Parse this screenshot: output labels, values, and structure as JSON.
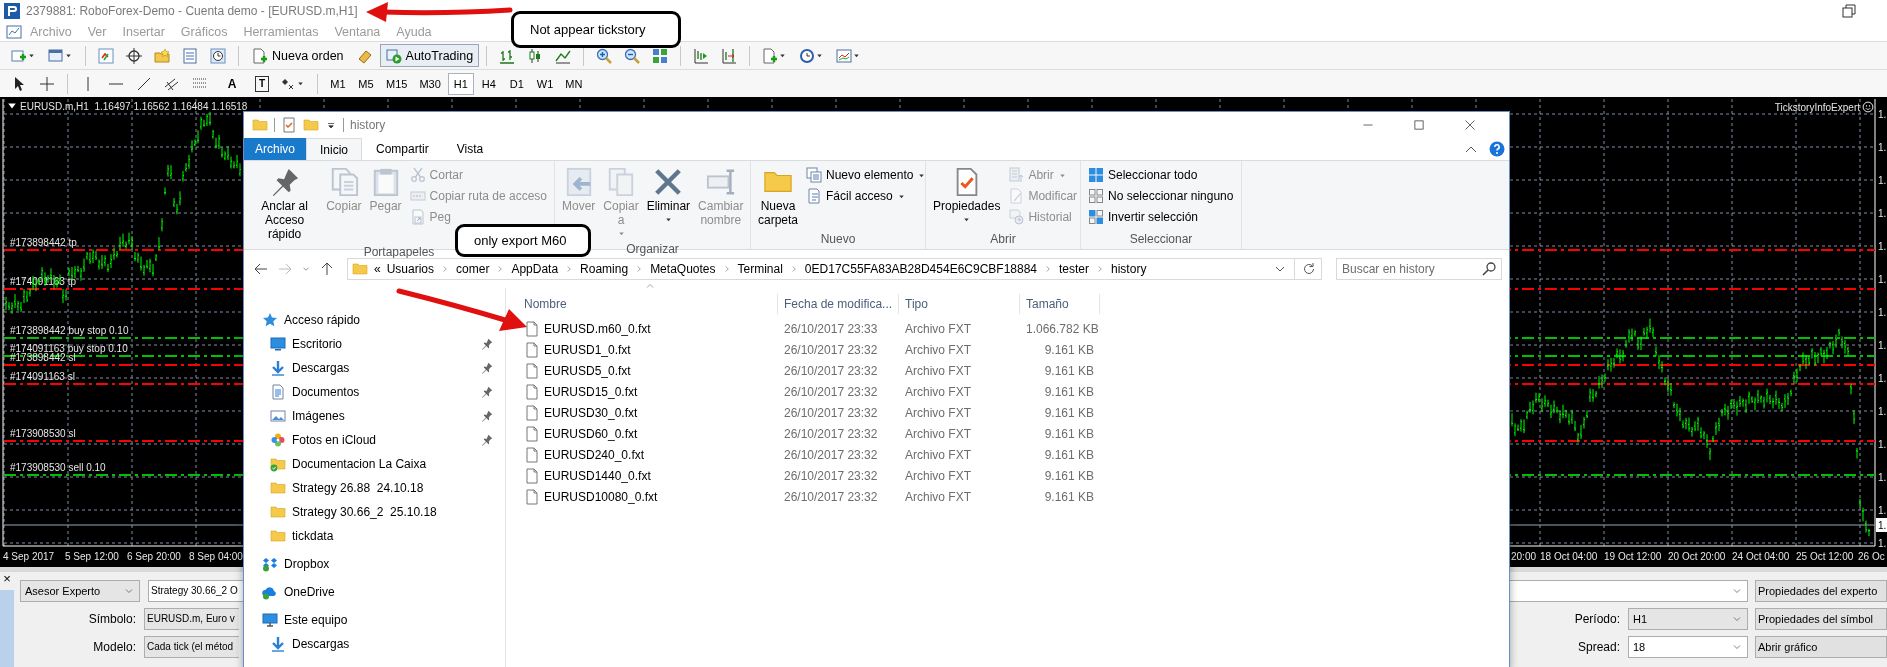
{
  "mt4": {
    "title": "2379881: RoboForex-Demo - Cuenta demo - [EURUSD.m,H1]",
    "menu": [
      "Archivo",
      "Ver",
      "Insertar",
      "Gráficos",
      "Herramientas",
      "Ventana",
      "Ayuda"
    ],
    "toolbar_buttons": [
      {
        "label": "Nueva orden",
        "pressed": false
      },
      {
        "label": "AutoTrading",
        "pressed": true
      }
    ],
    "tool_glyphs": [
      "A",
      "T"
    ],
    "timeframes": [
      {
        "label": "M1",
        "selected": false
      },
      {
        "label": "M5",
        "selected": false
      },
      {
        "label": "M15",
        "selected": false
      },
      {
        "label": "M30",
        "selected": false
      },
      {
        "label": "H1",
        "selected": true
      },
      {
        "label": "H4",
        "selected": false
      },
      {
        "label": "D1",
        "selected": false
      },
      {
        "label": "W1",
        "selected": false
      },
      {
        "label": "MN",
        "selected": false
      }
    ]
  },
  "chart": {
    "header": "EURUSD.m,H1  1.16497 1.16562 1.16484 1.16518",
    "expert": "TickstoryInfoExpert",
    "order_lines": [
      {
        "label": "#173898442 tp",
        "color": "#ff0000"
      },
      {
        "label": "#174091163 tp",
        "color": "#ff0000"
      },
      {
        "label": "#173898442 buy stop 0.10",
        "color": "#00c000"
      },
      {
        "label": "#174091163 buy stop 0.10",
        "color": "#00c000"
      },
      {
        "label": "#173898442 sl",
        "color": "#ff0000"
      },
      {
        "label": "#174091163 sl",
        "color": "#ff0000"
      },
      {
        "label": "#173908530 sl",
        "color": "#ff0000"
      },
      {
        "label": "#173908530 sell 0.10",
        "color": "#00c000"
      }
    ],
    "dates_left": [
      "4 Sep 2017",
      "5 Sep 12:00",
      "6 Sep 20:00",
      "8 Sep 04:00"
    ],
    "dates_right": [
      "20:00",
      "18 Oct 04:00",
      "19 Oct 12:00",
      "20 Oct 20:00",
      "24 Oct 04:00",
      "25 Oct 12:00",
      "26 Oc"
    ],
    "price_labels": [
      "1.",
      "1.",
      "1.",
      "1.",
      "1.",
      "1.",
      "1.",
      "1.",
      "1.",
      "1.",
      "1.",
      "1.",
      "1.",
      "1."
    ],
    "current_price": "1."
  },
  "tester": {
    "close": "×",
    "mode": "Asesor Experto",
    "expert": "Strategy 30.66_2 O",
    "fields": [
      {
        "label": "Símbolo:",
        "value": "EURUSD.m, Euro v"
      },
      {
        "label": "Modelo:",
        "value": "Cada tick (el métod"
      }
    ],
    "right_fields": [
      {
        "label": "Período:",
        "value": "H1"
      },
      {
        "label": "Spread:",
        "value": "18"
      }
    ],
    "buttons": [
      "Propiedades del experto",
      "Propiedades del símbol",
      "Abrir gráfico"
    ]
  },
  "explorer": {
    "title": "history",
    "tabs": [
      {
        "label": "Archivo",
        "kind": "file",
        "selected": false
      },
      {
        "label": "Inicio",
        "kind": "tab",
        "selected": true
      },
      {
        "label": "Compartir",
        "kind": "tab",
        "selected": false
      },
      {
        "label": "Vista",
        "kind": "tab",
        "selected": false
      }
    ],
    "ribbon": [
      {
        "label": "Portapapeles",
        "items": [
          {
            "label": "Anclar al\nAcceso rápido",
            "kind": "large",
            "disabled": false,
            "dropdown": false
          },
          {
            "label": "Copiar",
            "kind": "large",
            "disabled": true,
            "dropdown": false
          },
          {
            "label": "Pegar",
            "kind": "large",
            "disabled": true,
            "dropdown": false
          },
          {
            "label": "Cortar",
            "kind": "small",
            "disabled": true,
            "dropdown": false
          },
          {
            "label": "Copiar ruta de acceso",
            "kind": "small",
            "disabled": true,
            "dropdown": false
          },
          {
            "label": "Peg",
            "kind": "small",
            "disabled": true,
            "dropdown": false
          }
        ]
      },
      {
        "label": "Organizar",
        "items": [
          {
            "label": "Mover",
            "kind": "large",
            "disabled": true,
            "dropdown": false
          },
          {
            "label": "Copiar\na",
            "kind": "large",
            "disabled": true,
            "dropdown": true
          },
          {
            "label": "Eliminar",
            "kind": "large",
            "disabled": false,
            "dropdown": true
          },
          {
            "label": "Cambiar\nnombre",
            "kind": "large",
            "disabled": true,
            "dropdown": false
          }
        ]
      },
      {
        "label": "Nuevo",
        "items": [
          {
            "label": "Nueva\ncarpeta",
            "kind": "large",
            "disabled": false,
            "dropdown": false
          },
          {
            "label": "Nuevo elemento",
            "kind": "small",
            "disabled": false,
            "dropdown": true
          },
          {
            "label": "Fácil acceso",
            "kind": "small",
            "disabled": false,
            "dropdown": true
          }
        ]
      },
      {
        "label": "Abrir",
        "items": [
          {
            "label": "Propiedades",
            "kind": "large",
            "disabled": false,
            "dropdown": true
          },
          {
            "label": "Abrir",
            "kind": "small",
            "disabled": true,
            "dropdown": true
          },
          {
            "label": "Modificar",
            "kind": "small",
            "disabled": true,
            "dropdown": false
          },
          {
            "label": "Historial",
            "kind": "small",
            "disabled": true,
            "dropdown": false
          }
        ]
      },
      {
        "label": "Seleccionar",
        "items": [
          {
            "label": "Seleccionar todo",
            "kind": "small",
            "disabled": false,
            "dropdown": false
          },
          {
            "label": "No seleccionar ninguno",
            "kind": "small",
            "disabled": false,
            "dropdown": false
          },
          {
            "label": "Invertir selección",
            "kind": "small",
            "disabled": false,
            "dropdown": false
          }
        ]
      }
    ],
    "path_prefix": "«",
    "path": [
      "Usuarios",
      "comer",
      "AppData",
      "Roaming",
      "MetaQuotes",
      "Terminal",
      "0ED17C55FA83AB28D454E6C9CBF18884",
      "tester",
      "history"
    ],
    "search": {
      "placeholder": "Buscar en history"
    },
    "nav": [
      {
        "label": "Acceso rápido",
        "children": [
          {
            "label": "Escritorio",
            "pinned": true
          },
          {
            "label": "Descargas",
            "pinned": true
          },
          {
            "label": "Documentos",
            "pinned": true
          },
          {
            "label": "Imágenes",
            "pinned": true
          },
          {
            "label": "Fotos en iCloud",
            "pinned": true
          },
          {
            "label": "Documentacion La Caixa",
            "pinned": false
          },
          {
            "label": "Strategy 26.88  24.10.18",
            "pinned": false
          },
          {
            "label": "Strategy 30.66_2  25.10.18",
            "pinned": false
          },
          {
            "label": "tickdata",
            "pinned": false
          }
        ]
      },
      {
        "label": "Dropbox"
      },
      {
        "label": "OneDrive"
      },
      {
        "label": "Este equipo",
        "children": [
          {
            "label": "Descargas",
            "pinned": false
          }
        ]
      }
    ],
    "columns": [
      "Nombre",
      "Fecha de modifica...",
      "Tipo",
      "Tamaño"
    ],
    "files": [
      {
        "name": "EURUSD.m60_0.fxt",
        "date": "26/10/2017 23:33",
        "type": "Archivo FXT",
        "size": "1.066.782 KB"
      },
      {
        "name": "EURUSD1_0.fxt",
        "date": "26/10/2017 23:32",
        "type": "Archivo FXT",
        "size": "9.161 KB"
      },
      {
        "name": "EURUSD5_0.fxt",
        "date": "26/10/2017 23:32",
        "type": "Archivo FXT",
        "size": "9.161 KB"
      },
      {
        "name": "EURUSD15_0.fxt",
        "date": "26/10/2017 23:32",
        "type": "Archivo FXT",
        "size": "9.161 KB"
      },
      {
        "name": "EURUSD30_0.fxt",
        "date": "26/10/2017 23:32",
        "type": "Archivo FXT",
        "size": "9.161 KB"
      },
      {
        "name": "EURUSD60_0.fxt",
        "date": "26/10/2017 23:32",
        "type": "Archivo FXT",
        "size": "9.161 KB"
      },
      {
        "name": "EURUSD240_0.fxt",
        "date": "26/10/2017 23:32",
        "type": "Archivo FXT",
        "size": "9.161 KB"
      },
      {
        "name": "EURUSD1440_0.fxt",
        "date": "26/10/2017 23:32",
        "type": "Archivo FXT",
        "size": "9.161 KB"
      },
      {
        "name": "EURUSD10080_0.fxt",
        "date": "26/10/2017 23:32",
        "type": "Archivo FXT",
        "size": "9.161 KB"
      }
    ]
  },
  "annotations": [
    {
      "text": "Not appear tickstory"
    },
    {
      "text": "only export M60"
    }
  ]
}
